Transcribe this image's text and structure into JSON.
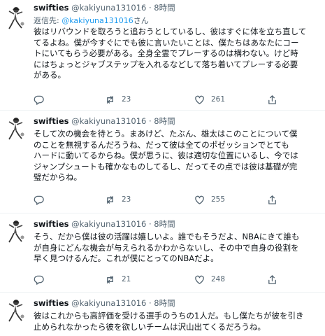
{
  "tweets": [
    {
      "author_name": "swifties",
      "handle_time": "@kakiyuna131016 · 8時間",
      "reply_label": "返信先:",
      "reply_target": "@kakiyuna131016",
      "reply_suffix": "さん",
      "text": "彼はリバウンドを取ろうと追おうとしているし、彼はすぐに体を立ち直して\nてるよね。僕が今すぐにでも彼に言いたいことは、僕たちはあなたにコー\nトにいてもらう必要がある。全身全霊でプレーするのは構わない。けど時\nにはちょっとジャブステップを入れるなどして落ち着いてプレーする必要\nがある。",
      "replies": "",
      "retweets": "23",
      "likes": "261"
    },
    {
      "author_name": "swifties",
      "handle_time": "@kakiyuna131016 · 8時間",
      "text": "そして次の機会を待とう。まあけど、たぶん、雄太はこのことについて僕\nのことを無視するんだろうね、だって彼は全てのポゼッションでとても\nハードに動いてるからね。僕が思うに、彼は適切な位置にいるし、今では\nジャンプシュートも確かなものしてるし、だってその点では彼は基礎が完\n璧だからね。",
      "replies": "",
      "retweets": "23",
      "likes": "255"
    },
    {
      "author_name": "swifties",
      "handle_time": "@kakiyuna131016 · 8時間",
      "text": "そう、だから僕は彼の活躍は嬉しいよ。誰でもそうだよ、NBAにきて誰も\nが自身にどんな機会が与えられるかわからないし、その中で自身の役割を\n早く見つけるんだ。これが僕にとってのNBAだよ。",
      "replies": "",
      "retweets": "21",
      "likes": "248"
    },
    {
      "author_name": "swifties",
      "handle_time": "@kakiyuna131016 · 8時間",
      "text": "彼はこれからも高評価を受ける選手のうちの1人だ。もし僕たちが彼を引き\n止められなかったら彼を欲しいチームは沢山出てくるだろうね。"
    }
  ],
  "icons": [
    "reply-icon",
    "retweet-icon",
    "like-icon",
    "share-icon"
  ],
  "colors": {
    "text": "#0f1419",
    "secondary": "#536471",
    "link": "#1d9bf0",
    "separator": "#eff3f4"
  }
}
